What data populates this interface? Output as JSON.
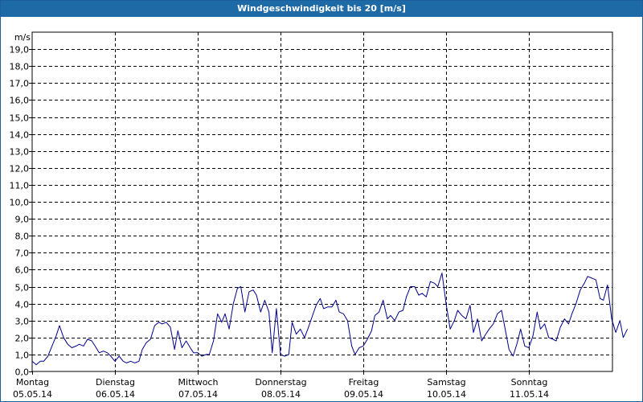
{
  "window": {
    "title": "Windgeschwindigkeit bis 20 [m/s]"
  },
  "colors": {
    "titlebar": "#1d6aa6",
    "line": "#00008b",
    "grid": "#000000",
    "background": "#ffffff"
  },
  "chart_data": {
    "type": "line",
    "title": "Windgeschwindigkeit bis 20 [m/s]",
    "ylabel": "m/s",
    "ylim": [
      0,
      20
    ],
    "y_ticks": [
      "0,0",
      "1,0",
      "2,0",
      "3,0",
      "4,0",
      "5,0",
      "6,0",
      "7,0",
      "8,0",
      "9,0",
      "10,0",
      "11,0",
      "12,0",
      "13,0",
      "14,0",
      "15,0",
      "16,0",
      "17,0",
      "18,0",
      "19,0"
    ],
    "x_ticks": [
      {
        "day": "Montag",
        "date": "05.05.14"
      },
      {
        "day": "Dienstag",
        "date": "06.05.14"
      },
      {
        "day": "Mittwoch",
        "date": "07.05.14"
      },
      {
        "day": "Donnerstag",
        "date": "08.05.14"
      },
      {
        "day": "Freitag",
        "date": "09.05.14"
      },
      {
        "day": "Samstag",
        "date": "10.05.14"
      },
      {
        "day": "Sonntag",
        "date": "11.05.14"
      }
    ],
    "xlim_days": [
      0,
      7
    ],
    "grid": true,
    "series": [
      {
        "values": [
          [
            0.0,
            0.6
          ],
          [
            0.05,
            0.4
          ],
          [
            0.1,
            0.6
          ],
          [
            0.14,
            0.6
          ],
          [
            0.19,
            0.9
          ],
          [
            0.24,
            1.5
          ],
          [
            0.29,
            2.1
          ],
          [
            0.33,
            2.7
          ],
          [
            0.38,
            2.0
          ],
          [
            0.43,
            1.6
          ],
          [
            0.48,
            1.4
          ],
          [
            0.53,
            1.5
          ],
          [
            0.57,
            1.6
          ],
          [
            0.62,
            1.5
          ],
          [
            0.67,
            1.9
          ],
          [
            0.72,
            1.8
          ],
          [
            0.76,
            1.5
          ],
          [
            0.81,
            1.1
          ],
          [
            0.86,
            1.2
          ],
          [
            0.91,
            1.1
          ],
          [
            0.95,
            0.9
          ],
          [
            1.0,
            0.6
          ],
          [
            1.05,
            0.9
          ],
          [
            1.1,
            0.6
          ],
          [
            1.14,
            0.5
          ],
          [
            1.19,
            0.6
          ],
          [
            1.24,
            0.5
          ],
          [
            1.29,
            0.6
          ],
          [
            1.33,
            1.3
          ],
          [
            1.38,
            1.7
          ],
          [
            1.43,
            1.9
          ],
          [
            1.48,
            2.7
          ],
          [
            1.53,
            2.9
          ],
          [
            1.57,
            2.8
          ],
          [
            1.62,
            2.9
          ],
          [
            1.67,
            2.6
          ],
          [
            1.72,
            1.3
          ],
          [
            1.76,
            2.4
          ],
          [
            1.81,
            1.4
          ],
          [
            1.86,
            1.8
          ],
          [
            1.91,
            1.4
          ],
          [
            1.95,
            1.1
          ],
          [
            2.0,
            1.1
          ],
          [
            2.05,
            0.9
          ],
          [
            2.1,
            1.0
          ],
          [
            2.14,
            1.0
          ],
          [
            2.19,
            1.8
          ],
          [
            2.24,
            3.4
          ],
          [
            2.29,
            2.9
          ],
          [
            2.33,
            3.4
          ],
          [
            2.38,
            2.5
          ],
          [
            2.43,
            4.0
          ],
          [
            2.48,
            4.9
          ],
          [
            2.52,
            5.0
          ],
          [
            2.57,
            3.5
          ],
          [
            2.62,
            4.7
          ],
          [
            2.67,
            4.8
          ],
          [
            2.71,
            4.5
          ],
          [
            2.76,
            3.5
          ],
          [
            2.81,
            4.2
          ],
          [
            2.86,
            3.5
          ],
          [
            2.9,
            1.1
          ],
          [
            2.95,
            3.7
          ],
          [
            3.0,
            1.0
          ],
          [
            3.05,
            0.9
          ],
          [
            3.1,
            1.0
          ],
          [
            3.14,
            2.9
          ],
          [
            3.19,
            2.2
          ],
          [
            3.24,
            2.5
          ],
          [
            3.29,
            2.0
          ],
          [
            3.33,
            2.5
          ],
          [
            3.38,
            3.2
          ],
          [
            3.43,
            3.9
          ],
          [
            3.48,
            4.3
          ],
          [
            3.52,
            3.7
          ],
          [
            3.57,
            3.8
          ],
          [
            3.62,
            3.8
          ],
          [
            3.67,
            4.2
          ],
          [
            3.71,
            3.5
          ],
          [
            3.76,
            3.4
          ],
          [
            3.81,
            3.0
          ],
          [
            3.86,
            1.5
          ],
          [
            3.9,
            1.0
          ],
          [
            3.95,
            1.4
          ],
          [
            4.0,
            1.5
          ],
          [
            4.05,
            1.9
          ],
          [
            4.1,
            2.4
          ],
          [
            4.14,
            3.3
          ],
          [
            4.19,
            3.5
          ],
          [
            4.24,
            4.2
          ],
          [
            4.29,
            3.1
          ],
          [
            4.33,
            3.3
          ],
          [
            4.38,
            3.0
          ],
          [
            4.43,
            3.5
          ],
          [
            4.48,
            3.6
          ],
          [
            4.52,
            4.4
          ],
          [
            4.57,
            5.0
          ],
          [
            4.62,
            5.0
          ],
          [
            4.67,
            4.5
          ],
          [
            4.71,
            4.6
          ],
          [
            4.76,
            4.4
          ],
          [
            4.81,
            5.3
          ],
          [
            4.86,
            5.2
          ],
          [
            4.9,
            5.0
          ],
          [
            4.95,
            5.8
          ],
          [
            5.0,
            4.0
          ],
          [
            5.05,
            2.5
          ],
          [
            5.1,
            3.0
          ],
          [
            5.14,
            3.6
          ],
          [
            5.19,
            3.3
          ],
          [
            5.24,
            3.1
          ],
          [
            5.29,
            3.9
          ],
          [
            5.33,
            2.3
          ],
          [
            5.38,
            3.1
          ],
          [
            5.43,
            1.8
          ],
          [
            5.48,
            2.2
          ],
          [
            5.52,
            2.5
          ],
          [
            5.57,
            2.8
          ],
          [
            5.62,
            3.4
          ],
          [
            5.67,
            3.6
          ],
          [
            5.71,
            2.6
          ],
          [
            5.76,
            1.3
          ],
          [
            5.81,
            0.9
          ],
          [
            5.86,
            1.7
          ],
          [
            5.9,
            2.5
          ],
          [
            5.95,
            1.5
          ],
          [
            6.0,
            1.4
          ],
          [
            6.05,
            2.1
          ],
          [
            6.1,
            3.5
          ],
          [
            6.14,
            2.5
          ],
          [
            6.19,
            2.8
          ],
          [
            6.24,
            2.0
          ],
          [
            6.29,
            1.9
          ],
          [
            6.33,
            1.8
          ],
          [
            6.38,
            2.6
          ],
          [
            6.43,
            3.1
          ],
          [
            6.48,
            2.8
          ],
          [
            6.52,
            3.4
          ],
          [
            6.57,
            4.0
          ],
          [
            6.62,
            4.8
          ],
          [
            6.67,
            5.2
          ],
          [
            6.71,
            5.6
          ],
          [
            6.76,
            5.5
          ],
          [
            6.81,
            5.4
          ],
          [
            6.86,
            4.3
          ],
          [
            6.9,
            4.2
          ],
          [
            6.95,
            5.1
          ],
          [
            7.0,
            3.1
          ],
          [
            7.05,
            2.3
          ],
          [
            7.1,
            3.0
          ],
          [
            7.14,
            2.0
          ],
          [
            7.19,
            2.5
          ]
        ]
      }
    ]
  }
}
